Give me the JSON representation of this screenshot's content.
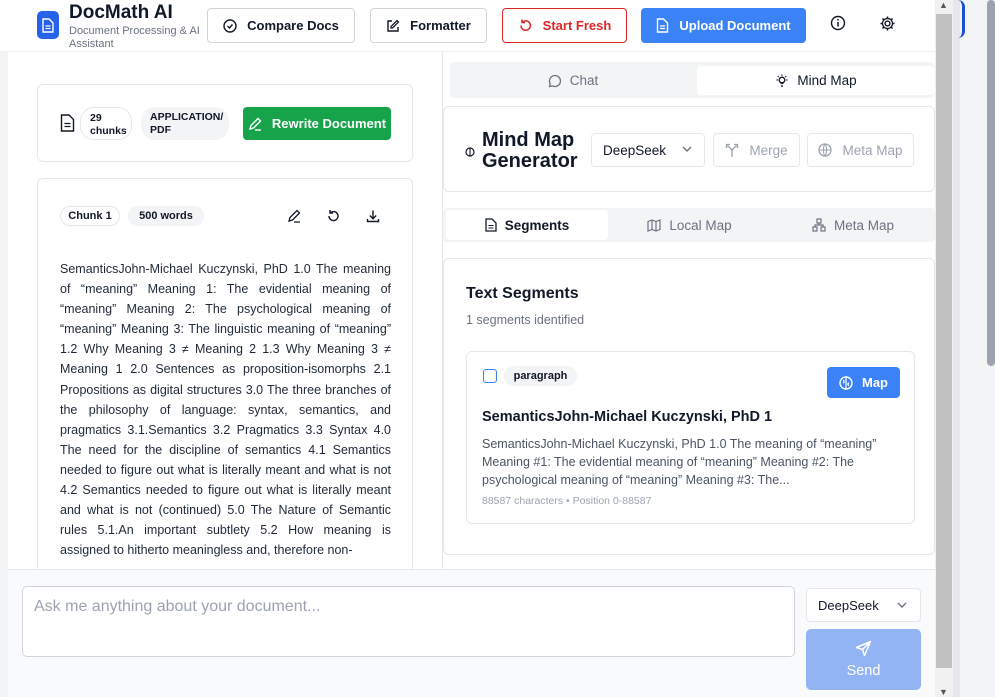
{
  "header": {
    "title": "DocMath AI",
    "subtitle": "Document Processing & AI Assistant",
    "buttons": {
      "compare": "Compare Docs",
      "formatter": "Formatter",
      "start_fresh": "Start Fresh",
      "upload": "Upload Document"
    }
  },
  "document": {
    "chunks_count": "29",
    "chunks_label": "chunks",
    "type_line1": "APPLICATION/",
    "type_line2": "PDF",
    "rewrite_label": "Rewrite Document"
  },
  "chunk": {
    "label": "Chunk 1",
    "words": "500 words",
    "text": "SemanticsJohn-Michael Kuczynski, PhD 1.0 The meaning of “meaning” Meaning 1: The evidential meaning of “meaning” Meaning 2: The psychological meaning of “meaning” Meaning 3: The linguistic meaning of “meaning” 1.2 Why Meaning 3 ≠ Meaning 2 1.3 Why Meaning 3 ≠ Meaning 1 2.0 Sentences as proposition-isomorphs 2.1 Propositions as digital structures 3.0 The three branches of the philosophy of language: syntax, semantics, and pragmatics 3.1.Semantics 3.2 Pragmatics 3.3 Syntax 4.0 The need for the discipline of semantics 4.1 Semantics needed to figure out what is literally meant and what is not 4.2 Semantics needed to figure out what is literally meant and what is not (continued) 5.0 The Nature of Semantic rules 5.1.An important subtlety 5.2 How meaning is assigned to hitherto meaningless and, therefore non-"
  },
  "right_tabs": {
    "chat": "Chat",
    "mind_map": "Mind Map"
  },
  "mind_map": {
    "title_line1": "Mind Map",
    "title_line2": "Generator",
    "model": "DeepSeek",
    "merge": "Merge",
    "meta_map": "Meta Map"
  },
  "sub_tabs": {
    "segments": "Segments",
    "local_map": "Local Map",
    "meta_map": "Meta Map"
  },
  "segments": {
    "title": "Text Segments",
    "count": "1 segments identified",
    "items": [
      {
        "type": "paragraph",
        "map_label": "Map",
        "name": "SemanticsJohn-Michael Kuczynski, PhD 1",
        "preview": "SemanticsJohn-Michael Kuczynski, PhD 1.0 The meaning of “meaning” Meaning #1: The evidential meaning of “meaning” Meaning #2: The psychological meaning of “meaning” Meaning #3: The...",
        "meta": "88587 characters • Position 0-88587"
      }
    ]
  },
  "chat": {
    "placeholder": "Ask me anything about your document...",
    "model": "DeepSeek",
    "send": "Send"
  },
  "colors": {
    "primary": "#3b82f6",
    "success": "#16a34a",
    "danger": "#dc2626"
  }
}
